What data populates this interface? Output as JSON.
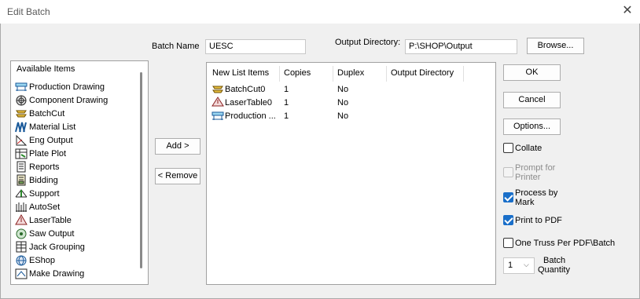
{
  "window": {
    "title": "Edit Batch",
    "close_icon": "close-icon"
  },
  "batch_name": {
    "label": "Batch Name",
    "value": "UESC"
  },
  "output_directory": {
    "label": "Output Directory:",
    "value": "P:\\SHOP\\Output",
    "browse_label": "Browse..."
  },
  "available": {
    "header": "Available Items",
    "items": [
      {
        "label": "Production Drawing",
        "icon": "production-drawing-icon"
      },
      {
        "label": "Component Drawing",
        "icon": "component-drawing-icon"
      },
      {
        "label": "BatchCut",
        "icon": "batchcut-icon"
      },
      {
        "label": "Material List",
        "icon": "material-list-icon"
      },
      {
        "label": "Eng Output",
        "icon": "eng-output-icon"
      },
      {
        "label": "Plate Plot",
        "icon": "plate-plot-icon"
      },
      {
        "label": "Reports",
        "icon": "reports-icon"
      },
      {
        "label": "Bidding",
        "icon": "bidding-icon"
      },
      {
        "label": "Support",
        "icon": "support-icon"
      },
      {
        "label": "AutoSet",
        "icon": "autoset-icon"
      },
      {
        "label": "LaserTable",
        "icon": "lasertable-icon"
      },
      {
        "label": "Saw Output",
        "icon": "saw-output-icon"
      },
      {
        "label": "Jack Grouping",
        "icon": "jack-grouping-icon"
      },
      {
        "label": "EShop",
        "icon": "eshop-icon"
      },
      {
        "label": "Make Drawing",
        "icon": "make-drawing-icon"
      }
    ]
  },
  "add_label": "Add >",
  "remove_label": "< Remove",
  "list": {
    "columns": [
      "New List Items",
      "Copies",
      "Duplex",
      "Output Directory"
    ],
    "rows": [
      {
        "name": "BatchCut0",
        "copies": "1",
        "duplex": "No",
        "icon": "batchcut-icon"
      },
      {
        "name": "LaserTable0",
        "copies": "1",
        "duplex": "No",
        "icon": "lasertable-icon"
      },
      {
        "name": "Production ...",
        "copies": "1",
        "duplex": "No",
        "icon": "production-drawing-icon"
      }
    ]
  },
  "buttons": {
    "ok": "OK",
    "cancel": "Cancel",
    "options": "Options..."
  },
  "checks": {
    "collate": {
      "label": "Collate",
      "checked": false
    },
    "prompt_printer": {
      "label_line1": "Prompt for",
      "label_line2": "Printer",
      "checked": false,
      "disabled": true
    },
    "process_mark": {
      "label_line1": "Process by",
      "label_line2": "Mark",
      "checked": true
    },
    "print_pdf": {
      "label": "Print to PDF",
      "checked": true
    },
    "one_truss": {
      "label": "One Truss Per PDF\\Batch",
      "checked": false
    }
  },
  "batch_quantity": {
    "value": "1",
    "label_line1": "Batch",
    "label_line2": "Quantity"
  },
  "colors": {
    "accent": "#1a6fc9",
    "background": "#f0f0f0"
  }
}
